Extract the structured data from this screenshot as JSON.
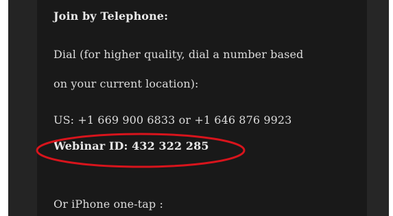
{
  "meeting_info": {
    "join_heading": "Join by Telephone:",
    "dial_instruction_line1": "Dial (for higher quality, dial a number based",
    "dial_instruction_line2": "on your current location):",
    "us_numbers": "US: +1 669 900 6833 or +1 646 876 9923",
    "webinar_id": "Webinar ID: 432 322 285",
    "iphone_one_tap": "Or iPhone one-tap :"
  },
  "annotation": {
    "ellipse_color": "#d8141c",
    "target": "webinar_id"
  },
  "colors": {
    "background": "#191919",
    "text": "#dcdcdc"
  }
}
